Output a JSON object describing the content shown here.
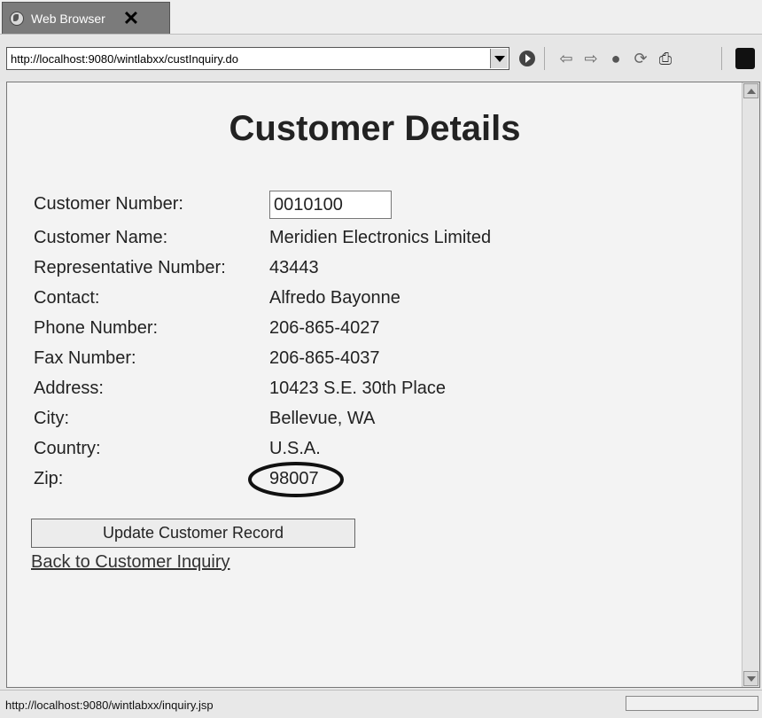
{
  "tab": {
    "title": "Web Browser",
    "close": "✕"
  },
  "toolbar": {
    "url": "http://localhost:9080/wintlabxx/custInquiry.do",
    "go": "▶",
    "back": "⇦",
    "forward": "⇨",
    "stop": "●",
    "refresh": "⟳",
    "print": "⎙"
  },
  "page": {
    "title": "Customer Details",
    "fields": [
      {
        "label": "Customer Number:",
        "value": "0010100"
      },
      {
        "label": "Customer Name:",
        "value": "Meridien Electronics Limited"
      },
      {
        "label": "Representative Number:",
        "value": "43443"
      },
      {
        "label": "Contact:",
        "value": "Alfredo Bayonne"
      },
      {
        "label": "Phone Number:",
        "value": "206-865-4027"
      },
      {
        "label": "Fax Number:",
        "value": "206-865-4037"
      },
      {
        "label": "Address:",
        "value": "10423 S.E. 30th Place"
      },
      {
        "label": "City:",
        "value": "Bellevue, WA"
      },
      {
        "label": "Country:",
        "value": "U.S.A."
      },
      {
        "label": "Zip:",
        "value": "98007"
      }
    ],
    "update_button": "Update Customer Record",
    "back_link": "Back to Customer Inquiry"
  },
  "status": {
    "text": "http://localhost:9080/wintlabxx/inquiry.jsp"
  },
  "colors": {
    "tab_bg": "#7b7b7b",
    "circle": "#111111",
    "page_bg": "#f3f3f3"
  }
}
